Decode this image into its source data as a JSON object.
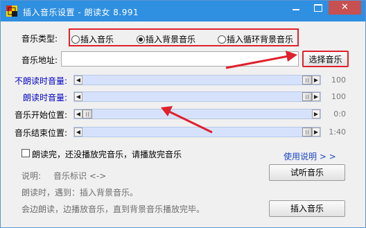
{
  "window": {
    "title": "插入音乐设置 - 朗读女 8.991",
    "close_glyph": "✕"
  },
  "music_type": {
    "label": "音乐类型:",
    "options": [
      {
        "label": "插入音乐",
        "selected": false
      },
      {
        "label": "插入背景音乐",
        "selected": true
      },
      {
        "label": "插入循环背景音乐",
        "selected": false
      }
    ]
  },
  "music_address": {
    "label": "音乐地址:",
    "value": "",
    "choose_button": "选择音乐"
  },
  "sliders": [
    {
      "label": "不朗读时音量:",
      "value": "100",
      "level": 1.0,
      "label_color": "#0000c8"
    },
    {
      "label": "朗读时音量:",
      "value": "100",
      "level": 1.0,
      "label_color": "#0000c8"
    },
    {
      "label": "音乐开始位置:",
      "value": "0:0",
      "level": 0.0,
      "label_color": "#000000"
    },
    {
      "label": "音乐结束位置:",
      "value": "1:40",
      "level": 1.0,
      "label_color": "#000000"
    }
  ],
  "checkbox": {
    "label": "朗读完，还没播放完音乐，请播放完音乐",
    "checked": false
  },
  "help_link": "使用说明 > >",
  "notes": {
    "line1_prefix": "说明:",
    "line1_rest": "音乐标识 <->",
    "line2": "朗读时，遇到：插入背景音乐。",
    "line3": "会边朗读，边播放音乐，直到背景音乐播放完毕。"
  },
  "buttons": {
    "preview": "试听音乐",
    "insert": "插入音乐"
  },
  "colors": {
    "titlebar": "#2f8fe0",
    "highlight_red": "#e0202c",
    "slider_track": "#d6e2fb"
  }
}
